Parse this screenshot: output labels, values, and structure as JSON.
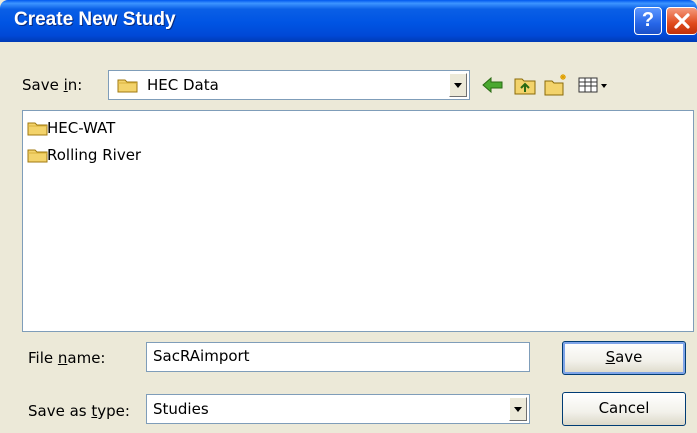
{
  "window": {
    "title": "Create New Study",
    "help_button": "?",
    "close_button": "✕"
  },
  "save_in": {
    "label_prefix": "Save ",
    "label_accel": "i",
    "label_suffix": "n:",
    "value": "HEC Data"
  },
  "toolbar": {
    "icons": [
      "back-icon",
      "up-folder-icon",
      "new-folder-icon",
      "view-menu-icon"
    ]
  },
  "files": [
    {
      "name": "HEC-WAT",
      "icon": "folder-icon"
    },
    {
      "name": "Rolling River",
      "icon": "folder-icon"
    }
  ],
  "file_name": {
    "label_prefix": "File ",
    "label_accel": "n",
    "label_suffix": "ame:",
    "value": "SacRAimport"
  },
  "save_as_type": {
    "label_prefix": "Save as ",
    "label_accel": "t",
    "label_suffix": "ype:",
    "value": "Studies"
  },
  "buttons": {
    "save_accel": "S",
    "save_rest": "ave",
    "cancel": "Cancel"
  },
  "colors": {
    "title_bar": "#0054e3",
    "dialog_bg": "#ece9d8",
    "folder": "#f3d36b"
  }
}
